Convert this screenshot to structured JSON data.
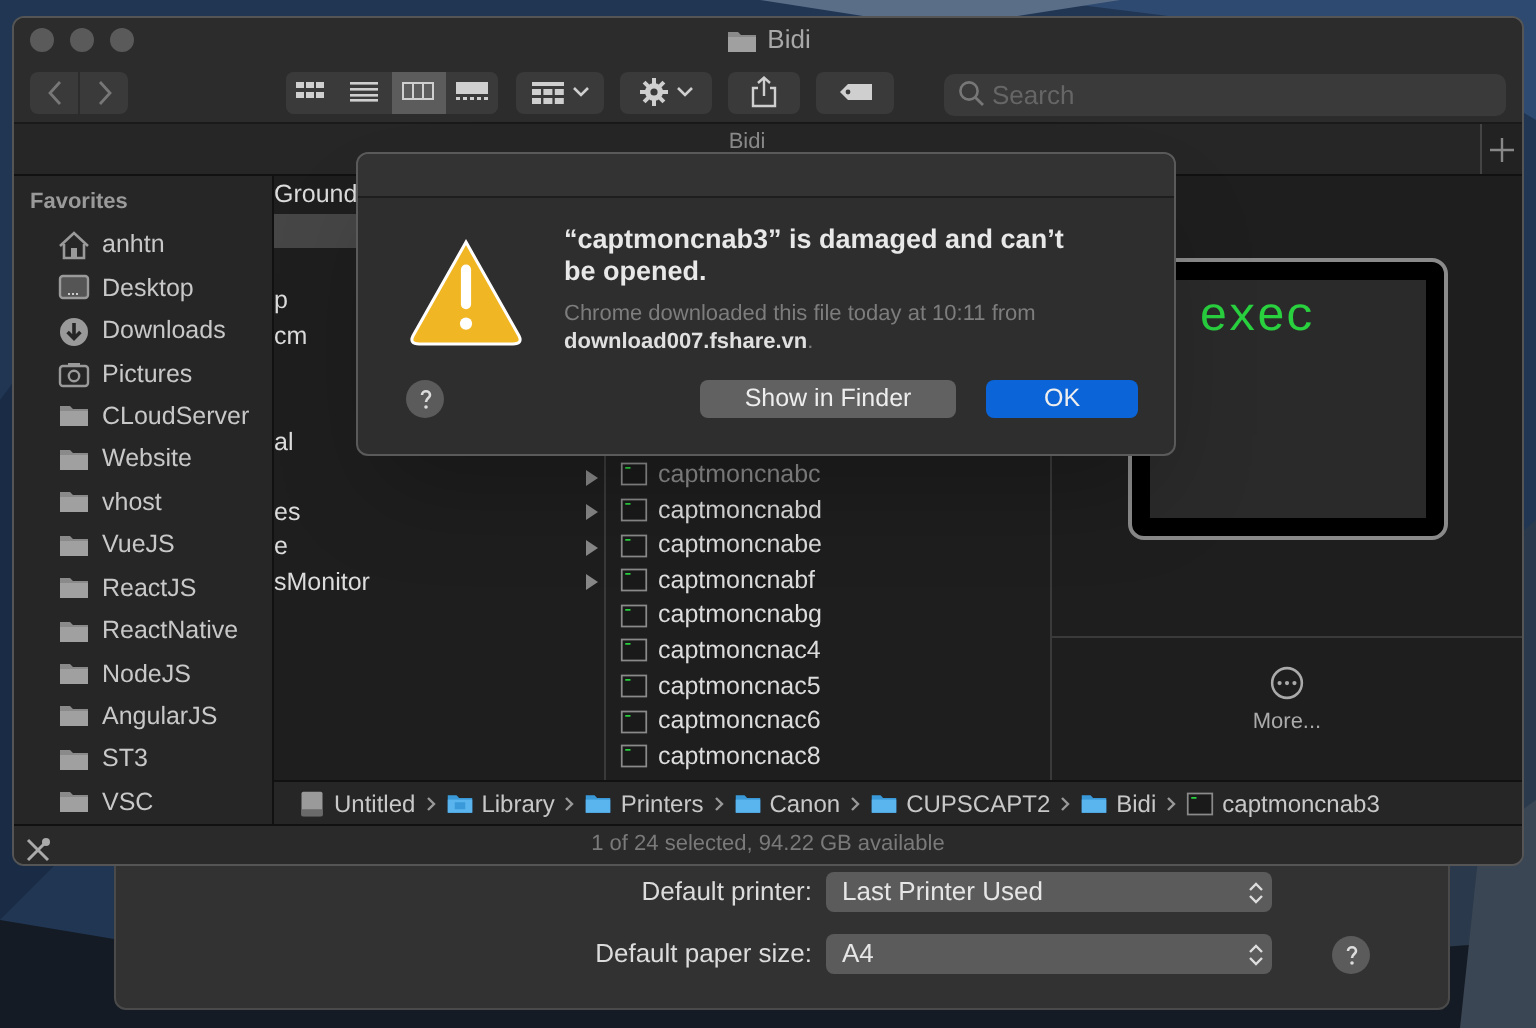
{
  "window": {
    "title": "Bidi"
  },
  "toolbar": {
    "views": [
      {
        "kind": "icons",
        "selected": false
      },
      {
        "kind": "list",
        "selected": false
      },
      {
        "kind": "columns",
        "selected": true
      },
      {
        "kind": "gallery",
        "selected": false
      }
    ],
    "search": {
      "placeholder": "Search"
    }
  },
  "tab": {
    "label": "Bidi"
  },
  "sidebar": {
    "heading": "Favorites",
    "items": [
      {
        "label": "anhtn",
        "kind": "home"
      },
      {
        "label": "Desktop",
        "kind": "desktop"
      },
      {
        "label": "Downloads",
        "kind": "downloads"
      },
      {
        "label": "Pictures",
        "kind": "pictures"
      },
      {
        "label": "CLoudServer",
        "kind": "folder"
      },
      {
        "label": "Website",
        "kind": "folder"
      },
      {
        "label": "vhost",
        "kind": "folder"
      },
      {
        "label": "VueJS",
        "kind": "folder"
      },
      {
        "label": "ReactJS",
        "kind": "folder"
      },
      {
        "label": "ReactNative",
        "kind": "folder"
      },
      {
        "label": "NodeJS",
        "kind": "folder"
      },
      {
        "label": "AngularJS",
        "kind": "folder"
      },
      {
        "label": "ST3",
        "kind": "folder"
      },
      {
        "label": "VSC",
        "kind": "folder"
      }
    ]
  },
  "column_2": [
    {
      "label": "Ground",
      "selected": false
    },
    {
      "selected": true
    },
    {
      "selected": false
    },
    {
      "label": "p",
      "selected": false
    },
    {
      "label": "cm",
      "selected": false
    },
    {
      "selected": false
    },
    {
      "selected": false
    },
    {
      "label": "al",
      "selected": false
    },
    {
      "selected": false,
      "arrow": true
    },
    {
      "label": "es",
      "selected": false,
      "arrow": true
    },
    {
      "label": "e",
      "selected": false,
      "arrow": true
    },
    {
      "label": "sMonitor",
      "selected": false,
      "arrow": true
    }
  ],
  "column_3": [
    {
      "label": "captmoncnabc",
      "dimmed": true
    },
    {
      "label": "captmoncnabd",
      "dimmed": false
    },
    {
      "label": "captmoncnabe",
      "dimmed": false
    },
    {
      "label": "captmoncnabf",
      "dimmed": false
    },
    {
      "label": "captmoncnabg",
      "dimmed": false
    },
    {
      "label": "captmoncnac4",
      "dimmed": false
    },
    {
      "label": "captmoncnac5",
      "dimmed": false
    },
    {
      "label": "captmoncnac6",
      "dimmed": false
    },
    {
      "label": "captmoncnac8",
      "dimmed": false
    }
  ],
  "preview": {
    "thumbnail_text": "exec",
    "more": "More..."
  },
  "path_bar": [
    {
      "label": "Untitled",
      "kind": "drive"
    },
    {
      "label": "Library",
      "kind": "library"
    },
    {
      "label": "Printers",
      "kind": "folder"
    },
    {
      "label": "Canon",
      "kind": "folder"
    },
    {
      "label": "CUPSCAPT2",
      "kind": "folder"
    },
    {
      "label": "Bidi",
      "kind": "folder"
    },
    {
      "label": "captmoncnab3",
      "kind": "exec"
    }
  ],
  "status_bar": "1 of 24 selected, 94.22 GB available",
  "dialog": {
    "title": "“captmoncnab3” is damaged and can’t be opened.",
    "message": "Chrome downloaded this file today at 10:11 from **download007.fshare.vn**.",
    "buttons": [
      {
        "label": "Show in Finder",
        "default": false
      },
      {
        "label": "OK",
        "default": true
      }
    ]
  },
  "printer_settings": {
    "rows": [
      {
        "label": "Default printer:",
        "value": "Last Printer Used"
      },
      {
        "label": "Default paper size:",
        "value": "A4"
      }
    ]
  }
}
